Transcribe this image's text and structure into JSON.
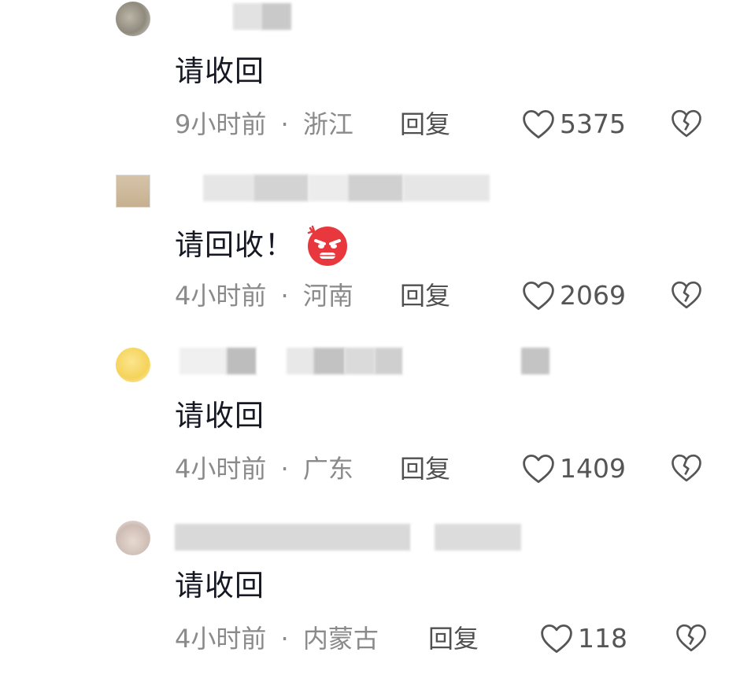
{
  "comments": [
    {
      "text": "请收回",
      "time": "9小时前",
      "sep": "·",
      "region": "浙江",
      "reply": "回复",
      "likes": "5375",
      "emoji": false
    },
    {
      "text": "请回收！",
      "time": "4小时前",
      "sep": "·",
      "region": "河南",
      "reply": "回复",
      "likes": "2069",
      "emoji": true
    },
    {
      "text": "请收回",
      "time": "4小时前",
      "sep": "·",
      "region": "广东",
      "reply": "回复",
      "likes": "1409",
      "emoji": false
    },
    {
      "text": "请收回",
      "time": "4小时前",
      "sep": "·",
      "region": "内蒙古",
      "reply": "回复",
      "likes": "118",
      "emoji": false
    }
  ],
  "icons": {
    "like": "heart-outline-icon",
    "dislike": "broken-heart-icon",
    "emoji": "angry-face-emoji"
  },
  "colors": {
    "text": "#161823",
    "meta": "#8a8a8a",
    "icon": "#555555",
    "emoji_red": "#e8383d"
  }
}
